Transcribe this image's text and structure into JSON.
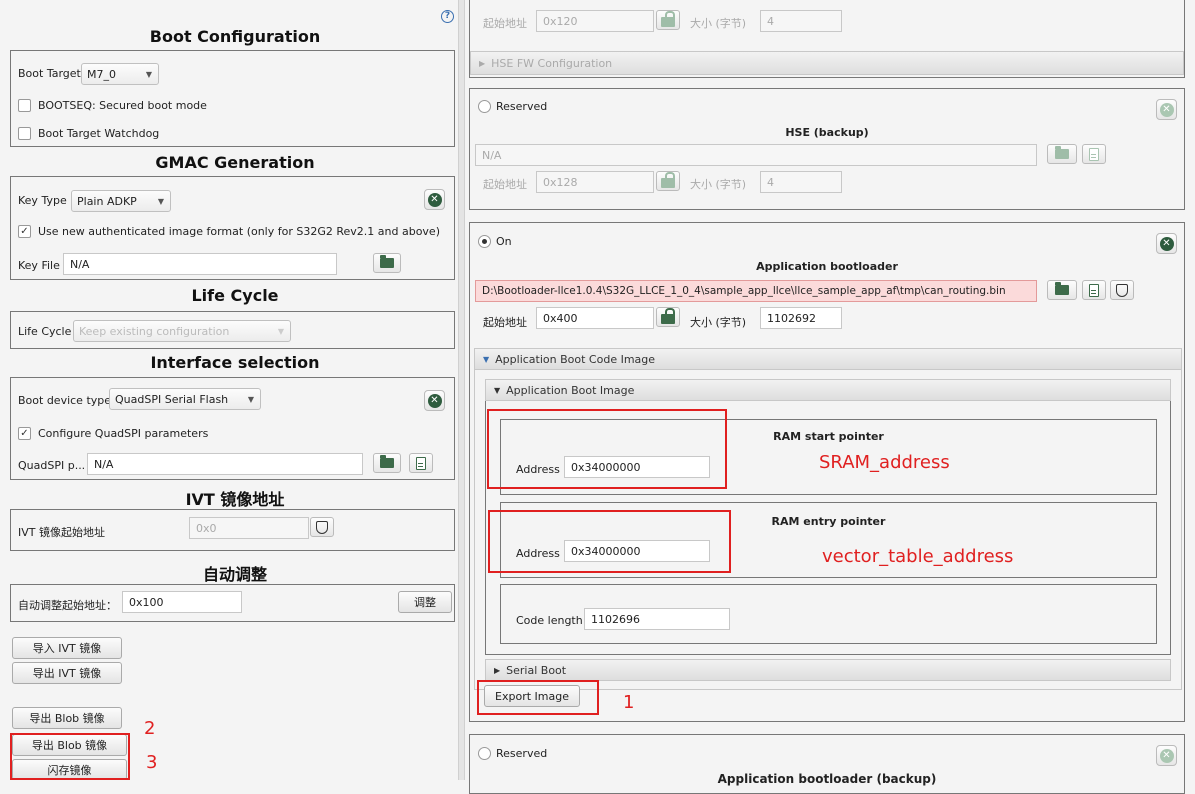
{
  "left": {
    "help": "?",
    "boot_config": {
      "title": "Boot Configuration",
      "boot_target_label": "Boot Target",
      "boot_target_value": "M7_0",
      "bootseq_label": "BOOTSEQ: Secured boot mode",
      "watchdog_label": "Boot Target Watchdog"
    },
    "gmac": {
      "title": "GMAC Generation",
      "key_type_label": "Key Type",
      "key_type_value": "Plain ADKP",
      "new_format_label": "Use new authenticated image format (only for S32G2 Rev2.1 and above)",
      "key_file_label": "Key File",
      "key_file_value": "N/A"
    },
    "life_cycle": {
      "title": "Life Cycle",
      "label": "Life Cycle",
      "value": "Keep existing configuration"
    },
    "interface": {
      "title": "Interface selection",
      "boot_device_label": "Boot device type",
      "boot_device_value": "QuadSPI Serial Flash",
      "configure_label": "Configure QuadSPI parameters",
      "quadspi_label": "QuadSPI p...",
      "quadspi_value": "N/A"
    },
    "ivt": {
      "title": "IVT 镜像地址",
      "label": "IVT 镜像起始地址",
      "value": "0x0"
    },
    "auto": {
      "title": "自动调整",
      "label": "自动调整起始地址：",
      "value": "0x100",
      "button": "调整"
    },
    "buttons": {
      "import_ivt": "导入 IVT 镜像",
      "export_ivt": "导出 IVT 镜像",
      "export_blob1": "导出 Blob 镜像",
      "export_blob2": "导出 Blob 镜像",
      "flash": "闪存镜像"
    },
    "annotations": {
      "two": "2",
      "three": "3"
    }
  },
  "right": {
    "top": {
      "start_label": "起始地址",
      "start_value": "0x120",
      "size_label": "大小 (字节)",
      "size_value": "4",
      "hse_fw_config": "HSE FW Configuration"
    },
    "hse_backup": {
      "radio_label": "Reserved",
      "title": "HSE (backup)",
      "path": "N/A",
      "start_label": "起始地址",
      "start_value": "0x128",
      "size_label": "大小 (字节)",
      "size_value": "4"
    },
    "app_bootloader": {
      "radio_label": "On",
      "title": "Application bootloader",
      "path": "D:\\Bootloader-llce1.0.4\\S32G_LLCE_1_0_4\\sample_app_llce\\llce_sample_app_af\\tmp\\can_routing.bin",
      "start_label": "起始地址",
      "start_value": "0x400",
      "size_label": "大小 (字节)",
      "size_value": "1102692",
      "code_image_header": "Application Boot Code Image",
      "boot_image_header": "Application Boot Image",
      "ram_start_title": "RAM start pointer",
      "ram_start_addr_label": "Address",
      "ram_start_addr_value": "0x34000000",
      "ram_entry_title": "RAM entry pointer",
      "ram_entry_addr_label": "Address",
      "ram_entry_addr_value": "0x34000000",
      "code_length_label": "Code length",
      "code_length_value": "1102696",
      "serial_boot": "Serial Boot",
      "export_button": "Export Image"
    },
    "app_backup": {
      "radio_label": "Reserved",
      "title": "Application bootloader (backup)"
    },
    "annotations": {
      "sram": "SRAM_address",
      "vector": "vector_table_address",
      "one": "1"
    }
  }
}
